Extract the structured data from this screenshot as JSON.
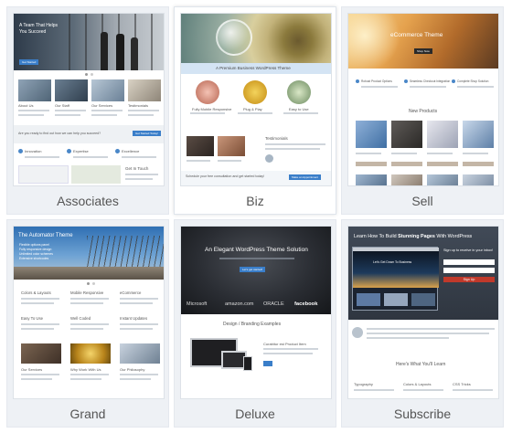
{
  "themes": [
    {
      "name": "Associates",
      "hero": {
        "line1": "A Team That Helps",
        "line2": "You Succeed",
        "button": "Get Started"
      },
      "sections": [
        "About Us",
        "Our Staff",
        "Our Services",
        "Testimonials"
      ],
      "cta": "Are you ready to find out how we can help you succeed?",
      "cta_button": "Get Started Today!",
      "features": [
        "Innovation",
        "Expertise",
        "Excellence"
      ],
      "contact": "Get In Touch"
    },
    {
      "name": "Biz",
      "banner": "A Premium Business WordPress Theme",
      "features": [
        "Fully Mobile Responsive",
        "Plug & Play",
        "Easy to Use"
      ],
      "section": "Testimonials",
      "cta": "Schedule your free consultation and get started today!",
      "cta_button": "Make an Appointment"
    },
    {
      "name": "Sell",
      "hero": {
        "title": "eCommerce Theme",
        "button": "Shop Now"
      },
      "features": [
        "Robust Product Options",
        "Seamless Checkout Integration",
        "Complete Shop Solution"
      ],
      "section": "New Products"
    },
    {
      "name": "Grand",
      "hero": {
        "title": "The Automator Theme",
        "bullets": [
          "Flexible options panel",
          "Fully responsive design",
          "Unlimited color schemes",
          "Extensive shortcodes"
        ]
      },
      "features": [
        "Colors & Layouts",
        "Mobile Responsive",
        "eCommerce",
        "Easy To Use",
        "Well Coded",
        "Instant Updates"
      ],
      "sections": [
        "Our Services",
        "Why Work With Us",
        "Our Philosophy"
      ]
    },
    {
      "name": "Deluxe",
      "hero": {
        "title": "An Elegant WordPress Theme Solution",
        "button": "Let's get started!"
      },
      "logos": [
        "Microsoft",
        "amazon.com",
        "ORACLE",
        "facebook"
      ],
      "section": "Design / Branding Examples",
      "product": "Curabitur est Product Item"
    },
    {
      "name": "Subscribe",
      "hero": {
        "title_pre": "Learn How To Build ",
        "title_bold": "Stunning Pages",
        "title_post": " With WordPress",
        "signup": "Sign up to receive in your inbox!",
        "button": "Sign Up",
        "mock_title": "Let's Get Down To Business"
      },
      "learn": "Here's What You'll Learn",
      "features": [
        "Typography",
        "Colors & Layouts",
        "CSS Tricks"
      ]
    }
  ]
}
